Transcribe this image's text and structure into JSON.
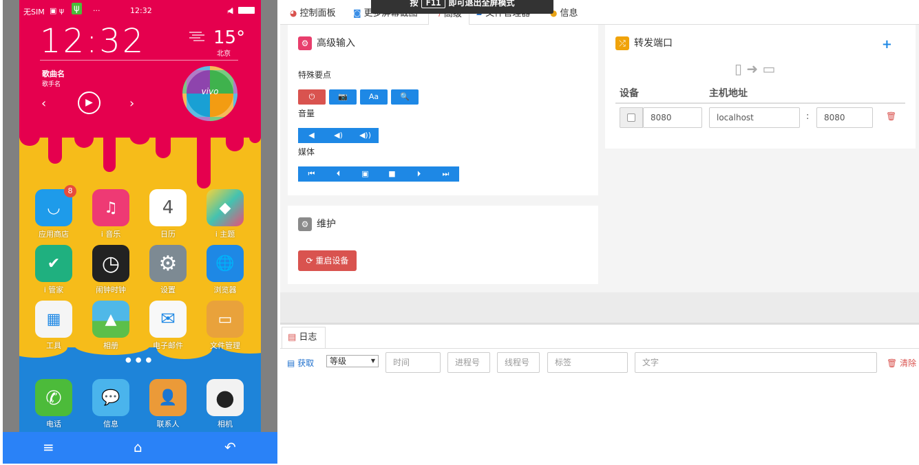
{
  "fullscreen_toast": {
    "prefix": "按",
    "key": "F11",
    "suffix": "即可退出全屏模式"
  },
  "phone": {
    "status": {
      "sim": "无SIM",
      "time": "12:32"
    },
    "lock_clock": "12:32",
    "weather": {
      "temp": "15°",
      "city": "北京"
    },
    "music": {
      "song": "歌曲名",
      "artist": "歌手名"
    },
    "disc_label": "vivo",
    "apps": [
      {
        "label": "应用商店",
        "badge": "8",
        "color": "#1e9bea",
        "glyph": "◡"
      },
      {
        "label": "i 音乐",
        "color": "#ee3a74",
        "glyph": "♫"
      },
      {
        "label": "日历",
        "color": "#ffffff",
        "glyph": "4"
      },
      {
        "label": "i 主题",
        "color": "#44c2b0",
        "glyph": "◆"
      },
      {
        "label": "i 管家",
        "color": "#1fb07f",
        "glyph": "✔"
      },
      {
        "label": "闹钟时钟",
        "color": "#222222",
        "glyph": "◷"
      },
      {
        "label": "设置",
        "color": "#7d8a93",
        "glyph": "⚙"
      },
      {
        "label": "浏览器",
        "color": "#1e88e5",
        "glyph": "🌐"
      },
      {
        "label": "工具",
        "color": "#f5f5f5",
        "glyph": "▦"
      },
      {
        "label": "相册",
        "color": "#4fb8e8",
        "glyph": "▲"
      },
      {
        "label": "电子邮件",
        "color": "#f8f8f8",
        "glyph": "✉"
      },
      {
        "label": "文件管理",
        "color": "#e9a23b",
        "glyph": "▭"
      }
    ],
    "dock": [
      {
        "label": "电话",
        "color": "#4cbb3a",
        "glyph": "✆"
      },
      {
        "label": "信息",
        "color": "#4ab4ec",
        "glyph": "💬"
      },
      {
        "label": "联系人",
        "color": "#eb9a38",
        "glyph": "👤"
      },
      {
        "label": "相机",
        "color": "#f2f2f2",
        "glyph": "●"
      }
    ]
  },
  "tabs": [
    {
      "label": "控制面板",
      "icon": "dashboard-icon"
    },
    {
      "label": "更多屏幕截图",
      "icon": "camera-icon"
    },
    {
      "label": "高级",
      "icon": "bolt-icon"
    },
    {
      "label": "文件管理器",
      "icon": "folder-icon"
    },
    {
      "label": "信息",
      "icon": "info-icon"
    }
  ],
  "advanced_input": {
    "title": "高级输入",
    "keys_label": "特殊要点",
    "volume_label": "音量",
    "media_label": "媒体",
    "key_buttons": [
      "⏻",
      "📷",
      "Aa",
      "🔍"
    ],
    "volume_buttons": [
      "◀",
      "◀)",
      "◀))"
    ],
    "media_buttons": [
      "⏮",
      "⏴",
      "▣",
      "■",
      "⏵",
      "⏭"
    ]
  },
  "maintenance": {
    "title": "维护",
    "reboot_label": "重启设备"
  },
  "port_forward": {
    "title": "转发端口",
    "add_label": "+",
    "col_device": "设备",
    "col_host": "主机地址",
    "rows": [
      {
        "device_port": "8080",
        "host": "localhost",
        "separator": ":",
        "host_port": "8080"
      }
    ]
  },
  "log": {
    "tab_label": "日志",
    "fetch_label": "获取",
    "level_label": "等级",
    "time_ph": "时间",
    "pid_ph": "进程号",
    "tid_ph": "线程号",
    "tag_ph": "标签",
    "text_ph": "文字",
    "clear_label": "清除"
  }
}
